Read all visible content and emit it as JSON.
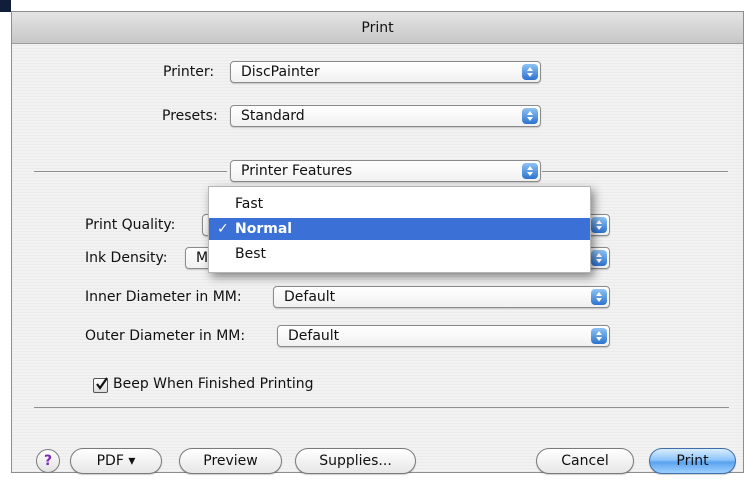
{
  "window": {
    "title": "Print"
  },
  "printer": {
    "label": "Printer:",
    "value": "DiscPainter"
  },
  "presets": {
    "label": "Presets:",
    "value": "Standard"
  },
  "panel": {
    "value": "Printer Features"
  },
  "print_quality": {
    "label": "Print Quality:",
    "options": [
      "Fast",
      "Normal",
      "Best"
    ],
    "selected": "Normal",
    "check_mark": "✓"
  },
  "ink_density": {
    "label": "Ink Density:",
    "value": "Matte 3"
  },
  "inner_diameter": {
    "label": "Inner Diameter in MM:",
    "value": "Default"
  },
  "outer_diameter": {
    "label": "Outer Diameter in MM:",
    "value": "Default"
  },
  "beep": {
    "label": "Beep When Finished Printing",
    "checked": true
  },
  "buttons": {
    "help": "?",
    "pdf": "PDF ▾",
    "preview": "Preview",
    "supplies": "Supplies...",
    "cancel": "Cancel",
    "print": "Print"
  },
  "colors": {
    "accent": "#3b71d6",
    "help_icon": "#7c2bbd"
  }
}
